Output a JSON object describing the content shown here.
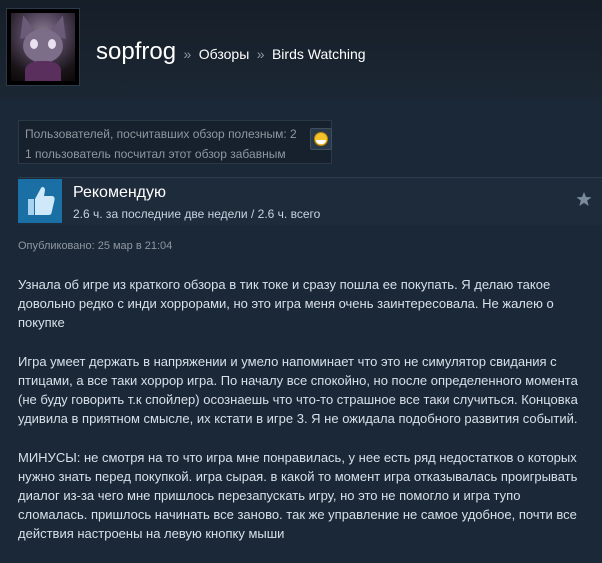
{
  "header": {
    "username": "sopfrog",
    "separator": "»",
    "crumb_reviews": "Обзоры",
    "crumb_game": "Birds Watching"
  },
  "helpful": {
    "line1": "Пользователей, посчитавших обзор полезным: 2",
    "line2": "1 пользователь посчитал этот обзор забавным"
  },
  "recommendation": {
    "title": "Рекомендую",
    "hours": "2.6 ч. за последние две недели / 2.6 ч. всего",
    "thumb_icon": "thumbs-up-icon",
    "award_icon": "star-icon"
  },
  "posted": "Опубликовано: 25 мар в 21:04",
  "review": {
    "paragraphs": [
      "Узнала об игре из краткого обзора в тик токе и сразу пошла ее покупать. Я делаю такое довольно редко с инди хоррорами, но это игра меня очень заинтересовала. Не жалею о покупке",
      "Игра умеет держать в напряжении и умело напоминает что это не симулятор свидания с птицами, а все таки хоррор игра. По началу все спокойно, но после определенного момента (не буду говорить т.к спойлер) осознаешь что что-то страшное все таки случиться. Концовка удивила в приятном смысле, их кстати в игре 3. Я не ожидала подобного развития событий.",
      "МИНУСЫ: не смотря на то что игра мне понравилась, у нее есть ряд недостатков о которых нужно знать перед покупкой. игра сырая. в какой то момент игра отказывалась проигрывать диалог из-за чего мне пришлось перезапускать игру, но это не помогло и игра тупо сломалась. пришлось начинать все заново. так же управление не самое удобное, почти все действия настроены на левую кнопку мыши"
    ]
  },
  "colors": {
    "background": "#1b2838",
    "thumb_bg": "#1a6fa4",
    "text": "#c6d4df",
    "muted": "#8f98a0"
  }
}
